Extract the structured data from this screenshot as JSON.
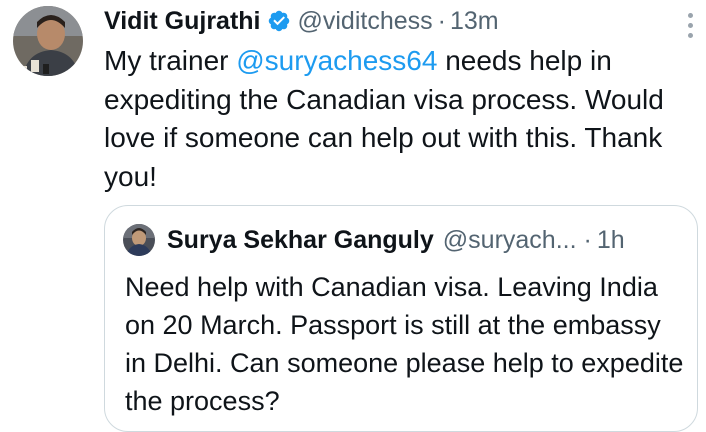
{
  "tweet": {
    "author": {
      "display_name": "Vidit Gujrathi",
      "handle": "@viditchess",
      "verified": true,
      "verified_color": "#1d9bf0",
      "avatar_icon": "profile-photo"
    },
    "separator": "·",
    "time": "13m",
    "more_icon": "more-vertical-icon",
    "text": {
      "before": "My trainer ",
      "mention": "@suryachess64",
      "after": " needs help in expediting the Canadian visa process. Would love if someone can help out with this. Thank you!"
    }
  },
  "quoted_tweet": {
    "author": {
      "display_name": "Surya Sekhar Ganguly",
      "handle": "@suryach...",
      "avatar_icon": "profile-photo"
    },
    "separator": "·",
    "time": "1h",
    "text": "Need help with Canadian visa. Leaving India on 20 March. Passport is still at the embassy in Delhi. Can someone please help to expedite the process?"
  },
  "colors": {
    "text_primary": "#0f1419",
    "text_secondary": "#536471",
    "link": "#1d9bf0",
    "border": "#cfd9de"
  }
}
